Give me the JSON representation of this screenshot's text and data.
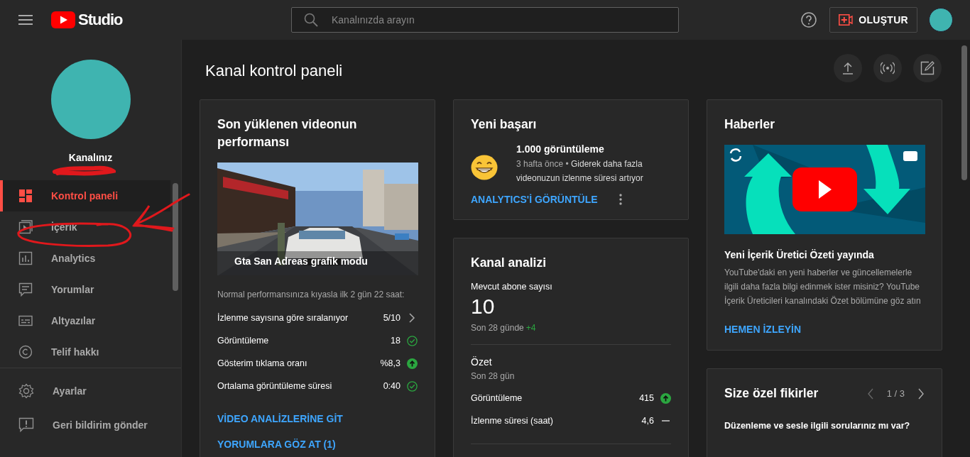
{
  "header": {
    "app_name": "Studio",
    "search": {
      "placeholder": "Kanalınızda arayın"
    },
    "create_button": "OLUŞTUR"
  },
  "sidebar": {
    "channel_label": "Kanalınız",
    "items": [
      {
        "label": "Kontrol paneli",
        "selected": true
      },
      {
        "label": "İçerik",
        "selected": false
      },
      {
        "label": "Analytics",
        "selected": false
      },
      {
        "label": "Yorumlar",
        "selected": false
      },
      {
        "label": "Altyazılar",
        "selected": false
      },
      {
        "label": "Telif hakkı",
        "selected": false
      }
    ],
    "bottom_items": [
      {
        "label": "Ayarlar"
      },
      {
        "label": "Geri bildirim gönder"
      }
    ]
  },
  "page_title": "Kanal kontrol paneli",
  "latest_video": {
    "title": "Son yüklenen videonun performansı",
    "video_title": "Gta San Adreas grafik modu",
    "note": "Normal performansınıza kıyasla ilk 2 gün 22 saat:",
    "metrics": [
      {
        "label": "İzlenme sayısına göre sıralanıyor",
        "value": "5/10",
        "kind": "rank"
      },
      {
        "label": "Görüntüleme",
        "value": "18",
        "kind": "ok"
      },
      {
        "label": "Gösterim tıklama oranı",
        "value": "%8,3",
        "kind": "up"
      },
      {
        "label": "Ortalama görüntüleme süresi",
        "value": "0:40",
        "kind": "ok"
      }
    ],
    "links": [
      "VİDEO ANALİZLERİNE GİT",
      "YORUMLARA GÖZ AT (1)"
    ]
  },
  "achievement": {
    "title": "Yeni başarı",
    "headline": "1.000 görüntüleme",
    "age": "3 hafta önce",
    "separator": "•",
    "detail": "Giderek daha fazla videonuzun izlenme süresi artıyor",
    "link": "ANALYTICS'İ GÖRÜNTÜLE"
  },
  "channel_analytics": {
    "title": "Kanal analizi",
    "subscribers_label": "Mevcut abone sayısı",
    "subscribers": "10",
    "change_label": "Son 28 günde",
    "change": "+4",
    "summary_title": "Özet",
    "summary_period": "Son 28 gün",
    "metrics": [
      {
        "label": "Görüntüleme",
        "value": "415",
        "kind": "up"
      },
      {
        "label": "İzlenme süresi (saat)",
        "value": "4,6",
        "kind": "flat"
      }
    ]
  },
  "news": {
    "title": "Haberler",
    "headline": "Yeni İçerik Üretici Özeti yayında",
    "body": "YouTube'daki en yeni haberler ve güncellemelerle ilgili daha fazla bilgi edinmek ister misiniz? YouTube İçerik Üreticileri kanalındaki Özet bölümüne göz atın",
    "link": "HEMEN İZLEYİN"
  },
  "ideas": {
    "title": "Size özel fikirler",
    "pager": "1 / 3",
    "question": "Düzenleme ve sesle ilgili sorularınız mı var?"
  }
}
